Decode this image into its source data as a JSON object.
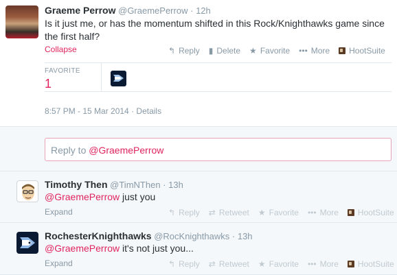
{
  "main_tweet": {
    "fullname": "Graeme Perrow",
    "handle": "@GraemePerrow",
    "separator": "·",
    "time": "12h",
    "text": "Is it just me, or has the momentum shifted in this Rock/Knighthawks game since the first half?",
    "collapse": "Collapse",
    "actions": {
      "reply": "Reply",
      "delete": "Delete",
      "favorite": "Favorite",
      "more": "More",
      "hootsuite": "HootSuite"
    },
    "stats": {
      "label": "FAVORITE",
      "count": "1"
    },
    "timestamp": "8:57 PM - 15 Mar 2014",
    "details": "Details",
    "icons": {
      "reply": "reply-icon",
      "delete": "trash-icon",
      "favorite": "star-icon",
      "more": "ellipsis-icon",
      "hootsuite": "hootsuite-icon"
    }
  },
  "reply_box": {
    "prefix": "Reply to",
    "mention": "@GraemePerrow"
  },
  "replies": [
    {
      "fullname": "Timothy Then",
      "handle": "@TimNThen",
      "separator": "·",
      "time": "13h",
      "mention": "@GraemePerrow",
      "text": " just you",
      "expand": "Expand",
      "actions": {
        "reply": "Reply",
        "retweet": "Retweet",
        "favorite": "Favorite",
        "more": "More",
        "hootsuite": "HootSuite"
      }
    },
    {
      "fullname": "RochesterKnighthawks",
      "handle": "@RocKnighthawks",
      "separator": "·",
      "time": "13h",
      "mention": "@GraemePerrow",
      "text": " it's not just you...",
      "expand": "Expand",
      "actions": {
        "reply": "Reply",
        "retweet": "Retweet",
        "favorite": "Favorite",
        "more": "More",
        "hootsuite": "HootSuite"
      }
    }
  ],
  "colors": {
    "accent": "#e0245e",
    "muted": "#8899a6",
    "text": "#292f33",
    "panel": "#f5f8fa"
  }
}
